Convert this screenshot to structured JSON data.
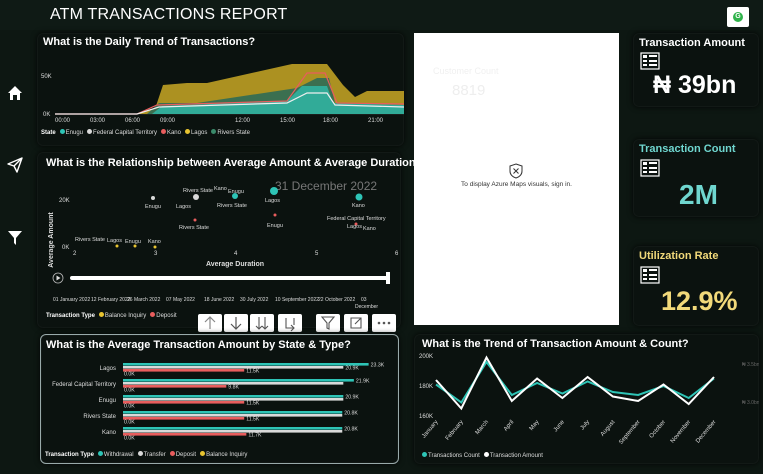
{
  "app": {
    "title": "ATM TRANSACTIONS REPORT",
    "logo_label": "G"
  },
  "nav": [
    {
      "name": "home-icon"
    },
    {
      "name": "send-icon"
    },
    {
      "name": "filter-icon"
    }
  ],
  "daily_trend": {
    "title": "What is the Daily Trend of Transactions?",
    "legend_title": "State",
    "legend": [
      {
        "label": "Enugu",
        "color": "#2ec4b6"
      },
      {
        "label": "Federal Capital Territory",
        "color": "#d9d9d9"
      },
      {
        "label": "Kano",
        "color": "#e85d5d"
      },
      {
        "label": "Lagos",
        "color": "#e8c430"
      },
      {
        "label": "Rivers State",
        "color": "#3a8a6a"
      }
    ],
    "chart_data": {
      "type": "area",
      "x_ticks": [
        "00:00",
        "03:00",
        "06:00",
        "09:00",
        "12:00",
        "15:00",
        "18:00",
        "21:00"
      ],
      "y_ticks": [
        "0K",
        "50K"
      ]
    }
  },
  "scatter": {
    "title": "What is the Relationship between Average Amount & Average Duration?",
    "overlay_date": "31 December 2022",
    "ylabel": "Average Amount",
    "xlabel": "Average Duration",
    "y_ticks": [
      "20K",
      "0K"
    ],
    "x_ticks": [
      "2",
      "3",
      "4",
      "5",
      "6"
    ],
    "point_labels": [
      "Enugu",
      "Rivers State",
      "Kano",
      "Enugu",
      "Lagos",
      "Rivers State",
      "Lagos",
      "Kano",
      "Rivers State",
      "Enugu",
      "Federal Capital Territory",
      "Lagos",
      "Kano",
      "Rivers State",
      "Lagos",
      "Enugu",
      "Kano"
    ],
    "timeline_ticks": [
      "01 January 2022",
      "12 February 2022",
      "26 March 2022",
      "07 May 2022",
      "18 June 2022",
      "30 July 2022",
      "10 September 2022",
      "22 October 2022",
      "03",
      "December"
    ],
    "legend_title": "Transaction Type",
    "legend": [
      {
        "label": "Balance Inquiry",
        "color": "#e8c430"
      },
      {
        "label": "Deposit",
        "color": "#e85d5d"
      }
    ]
  },
  "avg_amount": {
    "title": "What is the Average Transaction Amount by State & Type?",
    "chart_data": {
      "type": "bar",
      "categories": [
        "Lagos",
        "Federal Capital Territory",
        "Enugu",
        "Rivers State",
        "Kano"
      ],
      "series": [
        {
          "name": "Withdrawal",
          "values": [
            23.3,
            21.9,
            20.9,
            20.8,
            20.8
          ],
          "labels": [
            "23.3K",
            "21.9K",
            "20.9K",
            "20.8K",
            "20.8K"
          ],
          "color": "#2ec4b6"
        },
        {
          "name": "Transfer",
          "values": [
            20.9,
            20.9,
            20.9,
            20.8,
            20.8
          ],
          "labels": [
            "20.9K",
            "",
            "",
            "",
            ""
          ],
          "color": "#d9d9d9"
        },
        {
          "name": "Deposit",
          "values": [
            11.5,
            9.8,
            11.5,
            11.5,
            11.7
          ],
          "labels": [
            "11.5K",
            "9.8K",
            "11.5K",
            "11.5K",
            "11.7K"
          ],
          "color": "#e85d5d"
        },
        {
          "name": "Balance Inquiry",
          "values": [
            0,
            0,
            0,
            0,
            0
          ],
          "labels": [
            "0.0K",
            "0.0K",
            "0.0K",
            "0.0K",
            "0.0K"
          ],
          "color": "#e8c430"
        }
      ],
      "xlim": [
        0,
        24
      ]
    },
    "legend_title": "Transaction Type",
    "legend": [
      {
        "label": "Withdrawal",
        "color": "#2ec4b6"
      },
      {
        "label": "Transfer",
        "color": "#d9d9d9"
      },
      {
        "label": "Deposit",
        "color": "#e85d5d"
      },
      {
        "label": "Balance Inquiry",
        "color": "#e8c430"
      }
    ]
  },
  "trend_amount": {
    "title": "What is the Trend of Transaction Amount & Count?",
    "chart_data": {
      "type": "line",
      "x": [
        "January",
        "February",
        "March",
        "April",
        "May",
        "June",
        "July",
        "August",
        "September",
        "October",
        "November",
        "December"
      ],
      "series": [
        {
          "name": "Transactions Count",
          "values": [
            181,
            169,
            196,
            174,
            182,
            175,
            183,
            176,
            174,
            180,
            172,
            185
          ],
          "color": "#2ec4b6"
        },
        {
          "name": "Transaction Amount",
          "values": [
            184,
            165,
            199,
            170,
            185,
            172,
            186,
            173,
            170,
            181,
            168,
            186
          ],
          "color": "#ffffff"
        }
      ],
      "y_ticks": [
        "200K",
        "180K",
        "160K"
      ],
      "ylim": [
        160,
        200
      ],
      "right_ticks": [
        "₦ 3.5bn",
        "₦ 3.0bn"
      ]
    },
    "legend": [
      {
        "label": "Transactions Count",
        "color": "#2ec4b6"
      },
      {
        "label": "Transaction Amount",
        "color": "#ffffff"
      }
    ]
  },
  "map": {
    "sublabel": "Customer Count",
    "sublabel_value": "8819",
    "message": "To display Azure Maps visuals, sign in."
  },
  "kpis": [
    {
      "title": "Transaction Amount",
      "value": "₦ 39bn",
      "title_color": "#ffffff",
      "value_color": "#ffffff"
    },
    {
      "title": "Transaction Count",
      "value": "2M",
      "title_color": "#6fd6cf",
      "value_color": "#6fd6cf"
    },
    {
      "title": "Utilization Rate",
      "value": "12.9%",
      "title_color": "#f2d97a",
      "value_color": "#f2d97a"
    }
  ],
  "toolbar": [
    {
      "name": "drill-up-icon"
    },
    {
      "name": "drill-down-icon"
    },
    {
      "name": "expand-all-icon"
    },
    {
      "name": "expand-next-icon"
    },
    {
      "name": "filter-visual-icon"
    },
    {
      "name": "focus-mode-icon"
    },
    {
      "name": "more-options-icon"
    }
  ]
}
